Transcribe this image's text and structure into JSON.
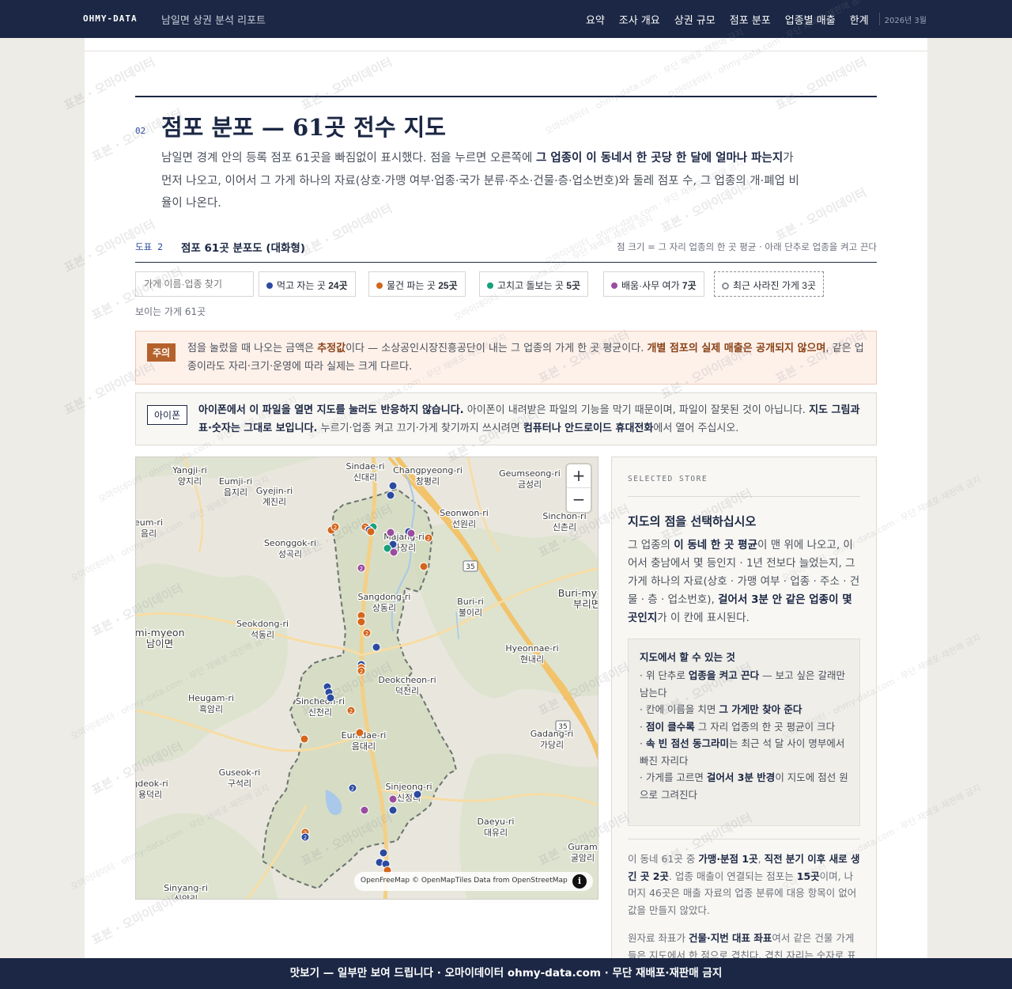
{
  "topbar": {
    "brand": "OHMY-DATA",
    "report_title": "남일면 상권 분석 리포트",
    "nav": [
      "요약",
      "조사 개요",
      "상권 규모",
      "점포 분포",
      "업종별 매출",
      "한계"
    ],
    "date": "2026년 3월"
  },
  "section": {
    "number": "02",
    "title": "점포 분포 — 61곳 전수 지도",
    "intro_1": "남일면 경계 안의 등록 점포 61곳을 빠짐없이 표시했다. 점을 누르면 오른쪽에 ",
    "intro_bold": "그 업종이 이 동네서 한 곳당 한 달에 얼마나 파는지",
    "intro_2": "가 먼저 나오고, 이어서 그 가게 하나의 자료(상호·가맹 여부·업종·국가 분류·주소·건물·층·업소번호)와 둘레 점포 수, 그 업종의 개·폐업 비율이 나온다."
  },
  "figure": {
    "label": "도표 2",
    "title": "점포 61곳 분포도 (대화형)",
    "note": "점 크기 = 그 자리 업종의 한 곳 평균 · 아래 단추로 업종을 켜고 끈다"
  },
  "filters": {
    "search_placeholder": "가게 이름·업종 찾기",
    "chips": [
      {
        "label": "먹고 자는 곳",
        "count": "24곳",
        "color": "#2b4aa0"
      },
      {
        "label": "물건 파는 곳",
        "count": "25곳",
        "color": "#d4661c"
      },
      {
        "label": "고치고 돌보는 곳",
        "count": "5곳",
        "color": "#17a07a"
      },
      {
        "label": "배움·사무 여가",
        "count": "7곳",
        "color": "#9a4d9e"
      },
      {
        "label": "최근 사라진 가게",
        "count": "3곳",
        "color": "#8a8f99"
      }
    ],
    "visible_count": "보이는 가게 61곳"
  },
  "warning": {
    "tag": "주의",
    "t1": "점을 눌렀을 때 나오는 금액은 ",
    "b1": "추정값",
    "t2": "이다 — 소상공인시장진흥공단이 내는 그 업종의 가게 한 곳 평균이다. ",
    "b2": "개별 점포의 실제 매출은 공개되지 않으며",
    "t3": ", 같은 업종이라도 자리·크기·운영에 따라 실제는 크게 다르다."
  },
  "iphone": {
    "tag": "아이폰",
    "b1": "아이폰에서 이 파일을 열면 지도를 눌러도 반응하지 않습니다.",
    "t1": " 아이폰이 내려받은 파일의 기능을 막기 때문이며, 파일이 잘못된 것이 아닙니다. ",
    "b2": "지도 그림과 표·숫자는 그대로 보입니다.",
    "t2": " 누르기·업종 켜고 끄기·가게 찾기까지 쓰시려면 ",
    "b3": "컴퓨터나 안드로이드 휴대전화",
    "t3": "에서 열어 주십시오."
  },
  "map": {
    "zoom_in": "+",
    "zoom_out": "−",
    "attribution": "OpenFreeMap © OpenMapTiles Data from OpenStreetMap",
    "info": "i",
    "road_35": "35",
    "places": [
      {
        "en": "Yangji-ri",
        "ko": "양지리"
      },
      {
        "en": "Eumji-ri",
        "ko": "읍지리"
      },
      {
        "en": "Gyejin-ri",
        "ko": "계진리"
      },
      {
        "en": "Sindae-ri",
        "ko": "신대리"
      },
      {
        "en": "Changpyeong-ri",
        "ko": "창평리"
      },
      {
        "en": "Geumseong-ri",
        "ko": "금성리"
      },
      {
        "en": "Seonwon-ri",
        "ko": "선원리"
      },
      {
        "en": "Sinchon-ri",
        "ko": "신촌리"
      },
      {
        "en": "eum-ri",
        "ko": "음리"
      },
      {
        "en": "Seonggok-ri",
        "ko": "성곡리"
      },
      {
        "en": "Majang-ri",
        "ko": "마장리"
      },
      {
        "en": "Buri-myeon",
        "ko": "부리면"
      },
      {
        "en": "Sangdong-ri",
        "ko": "상동리"
      },
      {
        "en": "Buri-ri",
        "ko": "불이리"
      },
      {
        "en": "Seokdong-ri",
        "ko": "석동리"
      },
      {
        "en": "mi-myeon",
        "ko": "남이면"
      },
      {
        "en": "Hyeonnae-ri",
        "ko": "현내리"
      },
      {
        "en": "Deokcheon-ri",
        "ko": "덕천리"
      },
      {
        "en": "Heugam-ri",
        "ko": "흑암리"
      },
      {
        "en": "Sincheon-ri",
        "ko": "신천리"
      },
      {
        "en": "Eumdae-ri",
        "ko": "음대리"
      },
      {
        "en": "Gadang-ri",
        "ko": "가당리"
      },
      {
        "en": "Guseok-ri",
        "ko": "구석리"
      },
      {
        "en": "gdeok-ri",
        "ko": "용덕리"
      },
      {
        "en": "Sinjeong-ri",
        "ko": "신정리"
      },
      {
        "en": "Daeyu-ri",
        "ko": "대유리"
      },
      {
        "en": "Guram",
        "ko": "굴암리"
      },
      {
        "en": "Sinyang-ri",
        "ko": "신양리"
      }
    ]
  },
  "panel": {
    "eyebrow": "SELECTED STORE",
    "title": "지도의 점을 선택하십시오",
    "d1": "그 업종의 ",
    "db1": "이 동네 한 곳 평균",
    "d2": "이 맨 위에 나오고, 이어서 충남에서 몇 등인지 · 1년 전보다 늘었는지, 그 가게 하나의 자료(상호 · 가맹 여부 · 업종 · 주소 · 건물 · 층 · 업소번호), ",
    "db2": "걸어서 3분 안 같은 업종이 몇 곳인지",
    "d3": "가 이 칸에 표시된다.",
    "howto_title": "지도에서 할 수 있는 것",
    "h1a": "· 위 단추로 ",
    "h1b": "업종을 켜고 끈다",
    "h1c": " — 보고 싶은 갈래만 남는다",
    "h2a": "· 칸에 이름을 치면 ",
    "h2b": "그 가게만 찾아 준다",
    "h3a": "· ",
    "h3b": "점이 클수록",
    "h3c": " 그 자리 업종의 한 곳 평균이 크다",
    "h4a": "· ",
    "h4b": "속 빈 점선 동그라미",
    "h4c": "는 최근 석 달 사이 명부에서 빠진 자리다",
    "h5a": "· 가게를 고르면 ",
    "h5b": "걸어서 3분 반경",
    "h5c": "이 지도에 점선 원으로 그려진다",
    "s1": "이 동네 61곳 중 ",
    "sb1": "가맹·분점 1곳",
    "s2": ", ",
    "sb2": "직전 분기 이후 새로 생긴 곳 2곳",
    "s3": ". 업종 매출이 연결되는 점포는 ",
    "sb3": "15곳",
    "s4": "이며, 나머지 46곳은 매출 자료의 업종 분류에 대응 항목이 없어 값을 만들지 않았다.",
    "c1": "원자료 좌표가 ",
    "cb1": "건물·지번 대표 좌표",
    "c2": "여서 같은 건물 가게들은 지도에서 한 점으로 겹친다. 겹친 자리는 숫자로 표시된다."
  },
  "watermark": {
    "main": "표본 · 오마이데이터",
    "sub": "오마이데이터 · ohmy-data.com · 무단 재배포·재판매 금지"
  },
  "footer": {
    "text": "맛보기 — 일부만 보여 드립니다 · 오마이데이터 ohmy-data.com · 무단 재배포·재판매 금지"
  }
}
